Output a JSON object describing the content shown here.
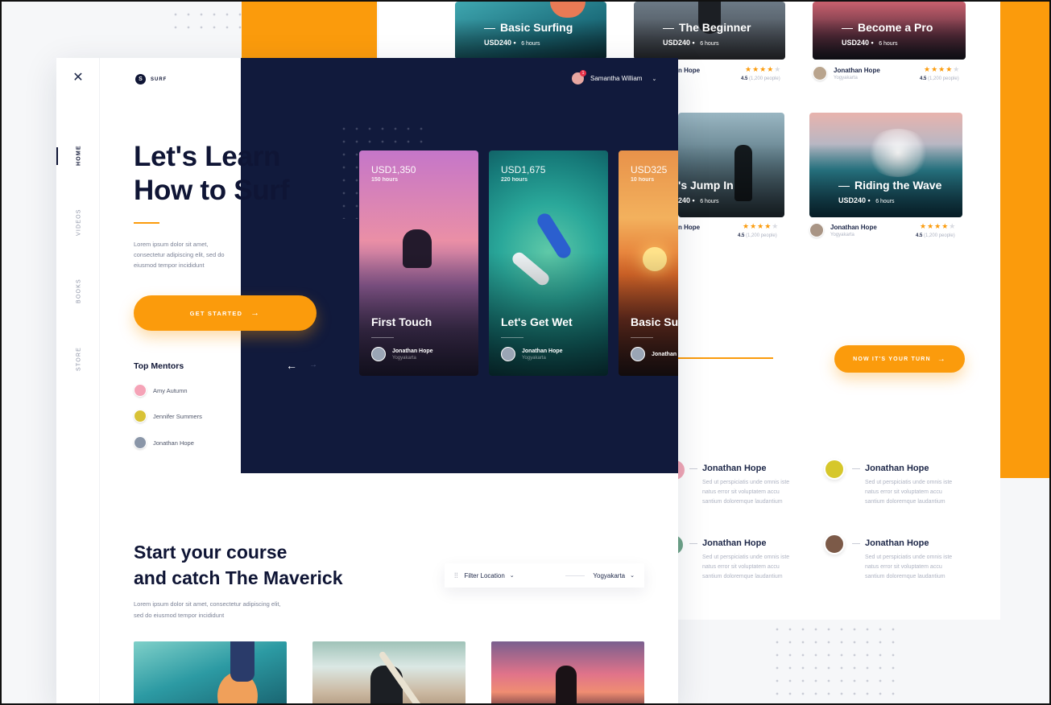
{
  "brand": {
    "name": "SURF",
    "logo_letter": "S"
  },
  "nav": [
    {
      "label": "HOME",
      "active": true
    },
    {
      "label": "VIDEOS",
      "active": false
    },
    {
      "label": "BOOKS",
      "active": false
    },
    {
      "label": "STORE",
      "active": false
    }
  ],
  "user": {
    "name": "Samantha William",
    "notification_count": "1"
  },
  "hero": {
    "title_line1": "Let's Learn",
    "title_line2": "How to Surf",
    "text_line1": "Lorem ipsum dolor sit amet,",
    "text_line2": "consectetur adipiscing elit, sed do",
    "text_line3": "eiusmod tempor incididunt",
    "cta": "GET STARTED"
  },
  "top_mentors": {
    "heading": "Top Mentors",
    "items": [
      {
        "name": "Amy Autumn"
      },
      {
        "name": "Jennifer Summers"
      },
      {
        "name": "Jonathan Hope"
      }
    ]
  },
  "slides": [
    {
      "price": "USD1,350",
      "hours": "150 hours",
      "title": "First Touch",
      "mentor": "Jonathan Hope",
      "location": "Yogyakarta"
    },
    {
      "price": "USD1,675",
      "hours": "220 hours",
      "title": "Let's Get Wet",
      "mentor": "Jonathan Hope",
      "location": "Yogyakarta"
    },
    {
      "price": "USD325",
      "hours": "10 hours",
      "title": "Basic Sur",
      "mentor": "Jonathan",
      "location": ""
    }
  ],
  "course_cards": [
    {
      "title": "Basic Surfing",
      "price": "USD240",
      "hours": "6 hours"
    },
    {
      "title": "The Beginner",
      "price": "USD240",
      "hours": "6 hours",
      "mentor": "n Hope",
      "rating": "4.5",
      "people": "(1,200 people)"
    },
    {
      "title": "Become a Pro",
      "price": "USD240",
      "hours": "6 hours",
      "mentor": "Jonathan Hope",
      "location": "Yogyakarta",
      "rating": "4.5",
      "people": "(1,200 people)"
    },
    {
      "title": "'s Jump In",
      "price": "240",
      "hours": "6 hours",
      "mentor": "n Hope",
      "rating": "4.5",
      "people": "(1,200 people)"
    },
    {
      "title": "Riding the Wave",
      "price": "USD240",
      "hours": "6 hours",
      "mentor": "Jonathan Hope",
      "location": "Yogyakarta",
      "rating": "4.5",
      "people": "(1,200 people)"
    }
  ],
  "your_turn": {
    "cta": "NOW IT'S YOUR TURN"
  },
  "testimonials": [
    {
      "name": "Jonathan Hope",
      "l1": "Sed ut perspiciatis unde omnis iste",
      "l2": "natus error sit voluptatem accu",
      "l3": "santium doloremque laudantium"
    },
    {
      "name": "Jonathan Hope",
      "l1": "Sed ut perspiciatis unde omnis iste",
      "l2": "natus error sit voluptatem accu",
      "l3": "santium doloremque laudantium"
    },
    {
      "name": "Jonathan Hope",
      "l1": "Sed ut perspiciatis unde omnis iste",
      "l2": "natus error sit voluptatem accu",
      "l3": "santium doloremque laudantium"
    },
    {
      "name": "Jonathan Hope",
      "l1": "Sed ut perspiciatis unde omnis iste",
      "l2": "natus error sit voluptatem accu",
      "l3": "santium doloremque laudantium"
    }
  ],
  "course_section": {
    "title_line1": "Start your course",
    "title_line2": "and catch The Maverick",
    "text_line1": "Lorem ipsum dolor sit amet, consectetur adipiscing elit,",
    "text_line2": "sed do eiusmod tempor incididunt",
    "filter_label": "Filter Location",
    "filter_value": "Yogyakarta"
  },
  "colors": {
    "accent": "#fb9b0c",
    "navy": "#111a3c",
    "text": "#0f1535"
  }
}
